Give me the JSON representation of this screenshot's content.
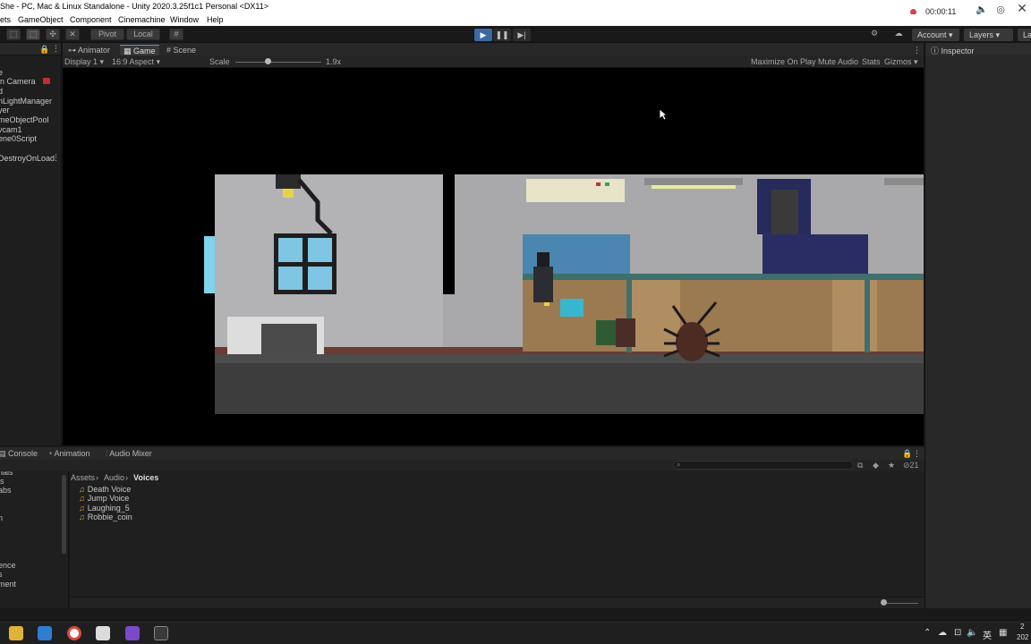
{
  "window": {
    "title": "She - PC, Mac & Linux Standalone - Unity 2020.3.25f1c1 Personal <DX11>",
    "record_time": "00:00:11"
  },
  "menu": [
    "ets",
    "GameObject",
    "Component",
    "Cinemachine",
    "Window",
    "Help"
  ],
  "toolbar": {
    "pivot": "Pivot",
    "local": "Local",
    "account": "Account",
    "layers": "Layers",
    "layout": "La"
  },
  "hierarchy": {
    "items": [
      "e",
      "in Camera",
      "d",
      "nLightManager",
      "yer",
      "meObjectPool",
      " vcam1",
      "ene0Script",
      "DestroyOnLoad"
    ]
  },
  "game_tabs": {
    "animator": "Animator",
    "game": "Game",
    "scene": "Scene"
  },
  "game_bar": {
    "display": "Display 1",
    "aspect": "16:9 Aspect",
    "scale_label": "Scale",
    "scale_value": "1.9x",
    "maximize": "Maximize On Play",
    "mute": "Mute Audio",
    "stats": "Stats",
    "gizmos": "Gizmos"
  },
  "inspector": {
    "title": "Inspector"
  },
  "bottom_tabs": {
    "console": "Console",
    "animation": "Animation",
    "audio_mixer": "Audio Mixer",
    "hidden_count": "21"
  },
  "project_tree": {
    "items": [
      "rials",
      "ls",
      "abs",
      "",
      "n",
      "",
      "",
      "",
      "",
      "ence",
      "s",
      "ment"
    ]
  },
  "breadcrumb": [
    "Assets",
    "Audio",
    "Voices"
  ],
  "files": [
    "Death Voice",
    "Jump Voice",
    "Laughing_5",
    "Robbie_coin"
  ],
  "taskbar": {
    "ime": "英",
    "clock_top": "2",
    "clock_bottom": "202"
  }
}
